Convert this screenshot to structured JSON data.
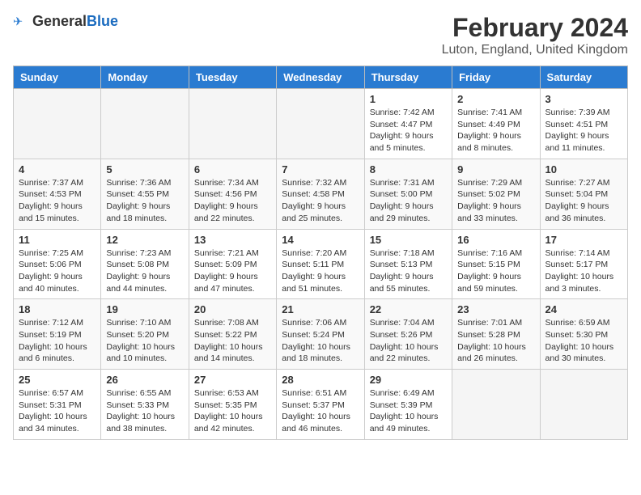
{
  "logo": {
    "text_general": "General",
    "text_blue": "Blue"
  },
  "header": {
    "month_year": "February 2024",
    "location": "Luton, England, United Kingdom"
  },
  "days_of_week": [
    "Sunday",
    "Monday",
    "Tuesday",
    "Wednesday",
    "Thursday",
    "Friday",
    "Saturday"
  ],
  "weeks": [
    [
      {
        "day": "",
        "info": ""
      },
      {
        "day": "",
        "info": ""
      },
      {
        "day": "",
        "info": ""
      },
      {
        "day": "",
        "info": ""
      },
      {
        "day": "1",
        "info": "Sunrise: 7:42 AM\nSunset: 4:47 PM\nDaylight: 9 hours\nand 5 minutes."
      },
      {
        "day": "2",
        "info": "Sunrise: 7:41 AM\nSunset: 4:49 PM\nDaylight: 9 hours\nand 8 minutes."
      },
      {
        "day": "3",
        "info": "Sunrise: 7:39 AM\nSunset: 4:51 PM\nDaylight: 9 hours\nand 11 minutes."
      }
    ],
    [
      {
        "day": "4",
        "info": "Sunrise: 7:37 AM\nSunset: 4:53 PM\nDaylight: 9 hours\nand 15 minutes."
      },
      {
        "day": "5",
        "info": "Sunrise: 7:36 AM\nSunset: 4:55 PM\nDaylight: 9 hours\nand 18 minutes."
      },
      {
        "day": "6",
        "info": "Sunrise: 7:34 AM\nSunset: 4:56 PM\nDaylight: 9 hours\nand 22 minutes."
      },
      {
        "day": "7",
        "info": "Sunrise: 7:32 AM\nSunset: 4:58 PM\nDaylight: 9 hours\nand 25 minutes."
      },
      {
        "day": "8",
        "info": "Sunrise: 7:31 AM\nSunset: 5:00 PM\nDaylight: 9 hours\nand 29 minutes."
      },
      {
        "day": "9",
        "info": "Sunrise: 7:29 AM\nSunset: 5:02 PM\nDaylight: 9 hours\nand 33 minutes."
      },
      {
        "day": "10",
        "info": "Sunrise: 7:27 AM\nSunset: 5:04 PM\nDaylight: 9 hours\nand 36 minutes."
      }
    ],
    [
      {
        "day": "11",
        "info": "Sunrise: 7:25 AM\nSunset: 5:06 PM\nDaylight: 9 hours\nand 40 minutes."
      },
      {
        "day": "12",
        "info": "Sunrise: 7:23 AM\nSunset: 5:08 PM\nDaylight: 9 hours\nand 44 minutes."
      },
      {
        "day": "13",
        "info": "Sunrise: 7:21 AM\nSunset: 5:09 PM\nDaylight: 9 hours\nand 47 minutes."
      },
      {
        "day": "14",
        "info": "Sunrise: 7:20 AM\nSunset: 5:11 PM\nDaylight: 9 hours\nand 51 minutes."
      },
      {
        "day": "15",
        "info": "Sunrise: 7:18 AM\nSunset: 5:13 PM\nDaylight: 9 hours\nand 55 minutes."
      },
      {
        "day": "16",
        "info": "Sunrise: 7:16 AM\nSunset: 5:15 PM\nDaylight: 9 hours\nand 59 minutes."
      },
      {
        "day": "17",
        "info": "Sunrise: 7:14 AM\nSunset: 5:17 PM\nDaylight: 10 hours\nand 3 minutes."
      }
    ],
    [
      {
        "day": "18",
        "info": "Sunrise: 7:12 AM\nSunset: 5:19 PM\nDaylight: 10 hours\nand 6 minutes."
      },
      {
        "day": "19",
        "info": "Sunrise: 7:10 AM\nSunset: 5:20 PM\nDaylight: 10 hours\nand 10 minutes."
      },
      {
        "day": "20",
        "info": "Sunrise: 7:08 AM\nSunset: 5:22 PM\nDaylight: 10 hours\nand 14 minutes."
      },
      {
        "day": "21",
        "info": "Sunrise: 7:06 AM\nSunset: 5:24 PM\nDaylight: 10 hours\nand 18 minutes."
      },
      {
        "day": "22",
        "info": "Sunrise: 7:04 AM\nSunset: 5:26 PM\nDaylight: 10 hours\nand 22 minutes."
      },
      {
        "day": "23",
        "info": "Sunrise: 7:01 AM\nSunset: 5:28 PM\nDaylight: 10 hours\nand 26 minutes."
      },
      {
        "day": "24",
        "info": "Sunrise: 6:59 AM\nSunset: 5:30 PM\nDaylight: 10 hours\nand 30 minutes."
      }
    ],
    [
      {
        "day": "25",
        "info": "Sunrise: 6:57 AM\nSunset: 5:31 PM\nDaylight: 10 hours\nand 34 minutes."
      },
      {
        "day": "26",
        "info": "Sunrise: 6:55 AM\nSunset: 5:33 PM\nDaylight: 10 hours\nand 38 minutes."
      },
      {
        "day": "27",
        "info": "Sunrise: 6:53 AM\nSunset: 5:35 PM\nDaylight: 10 hours\nand 42 minutes."
      },
      {
        "day": "28",
        "info": "Sunrise: 6:51 AM\nSunset: 5:37 PM\nDaylight: 10 hours\nand 46 minutes."
      },
      {
        "day": "29",
        "info": "Sunrise: 6:49 AM\nSunset: 5:39 PM\nDaylight: 10 hours\nand 49 minutes."
      },
      {
        "day": "",
        "info": ""
      },
      {
        "day": "",
        "info": ""
      }
    ]
  ]
}
